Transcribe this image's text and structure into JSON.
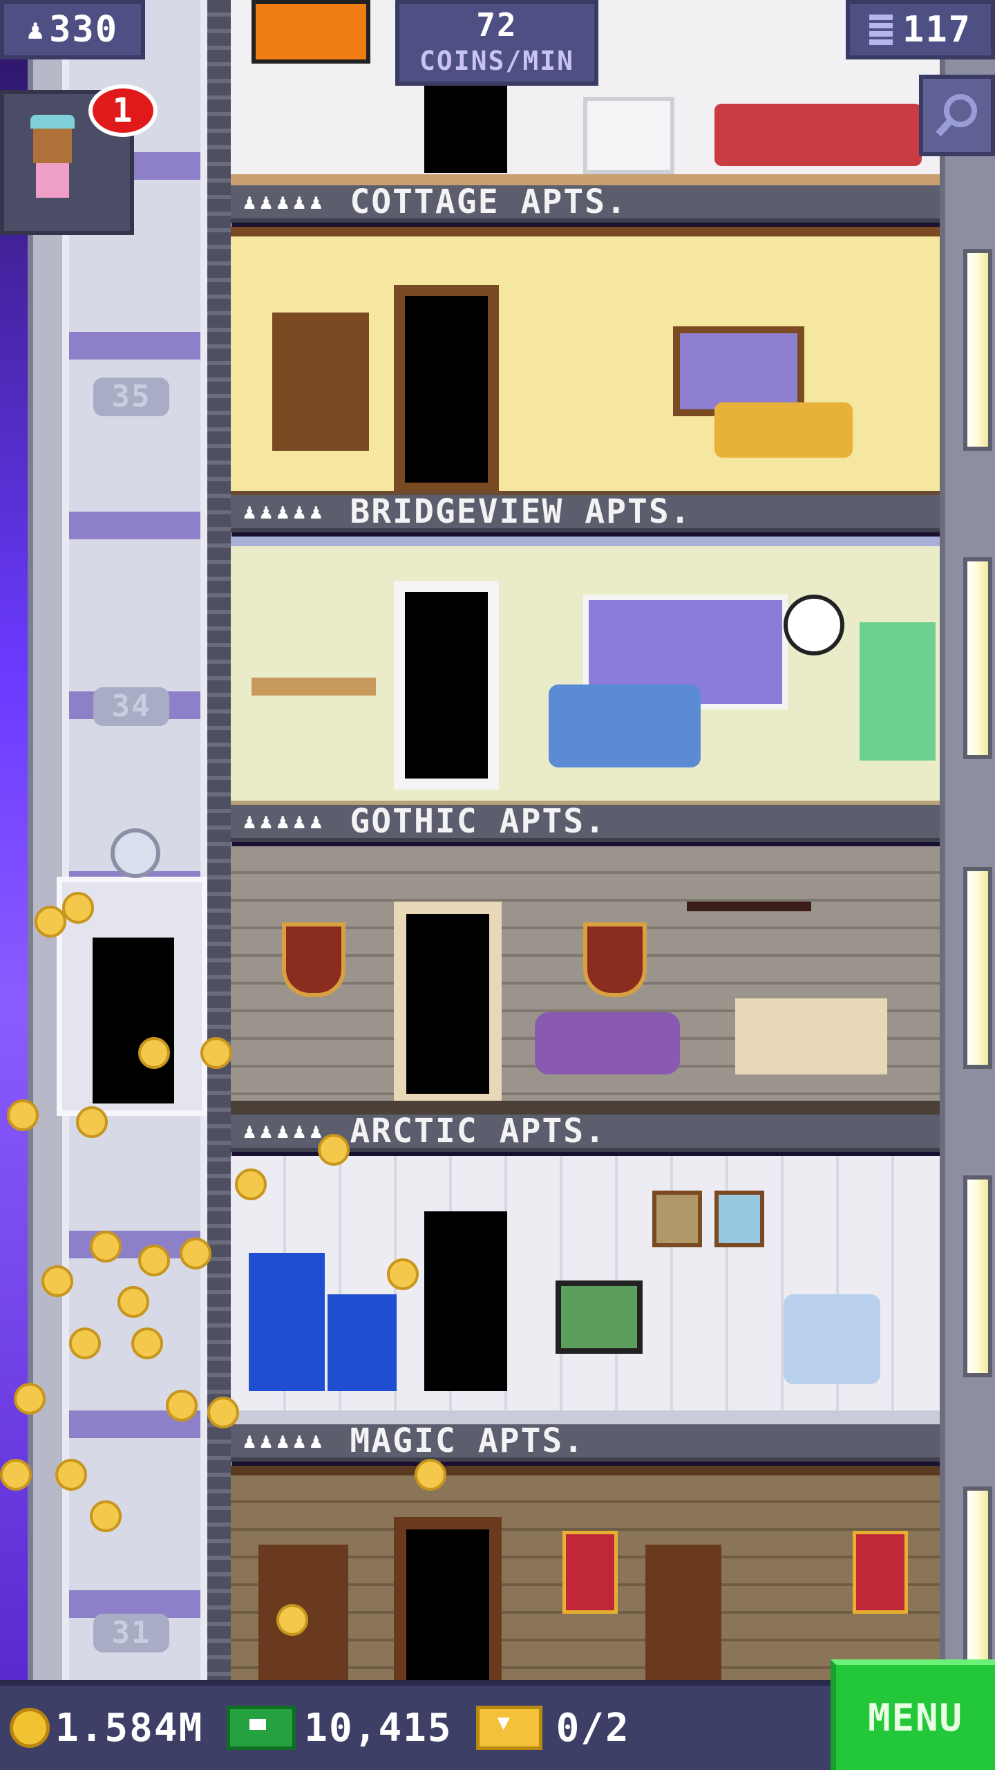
{
  "hud": {
    "population": "330",
    "coins_per_min_value": "72",
    "coins_per_min_label": "COINS/MIN",
    "floors_count": "117"
  },
  "visitor": {
    "notification_count": "1"
  },
  "floors": [
    {
      "name": "COTTAGE APTS.",
      "stars": "♟♟♟♟♟"
    },
    {
      "name": "BRIDGEVIEW APTS.",
      "stars": "♟♟♟♟♟"
    },
    {
      "name": "GOTHIC APTS.",
      "stars": "♟♟♟♟♟"
    },
    {
      "name": "ARCTIC APTS.",
      "stars": "♟♟♟♟♟"
    },
    {
      "name": "MAGIC APTS.",
      "stars": "♟♟♟♟♟"
    }
  ],
  "shaft_floor_numbers": [
    "35",
    "34",
    "31"
  ],
  "bottom": {
    "coins": "1.584M",
    "bux": "10,415",
    "tickets": "0/2",
    "menu_label": "MENU"
  },
  "colors": {
    "cottage_wall": "#f5e6a0",
    "bridgeview_wall": "#e9ebc9",
    "gothic_wall": "#9a948c",
    "arctic_wall": "#ececf2",
    "magic_wall": "#8a7558",
    "menu_green": "#22c73a"
  }
}
